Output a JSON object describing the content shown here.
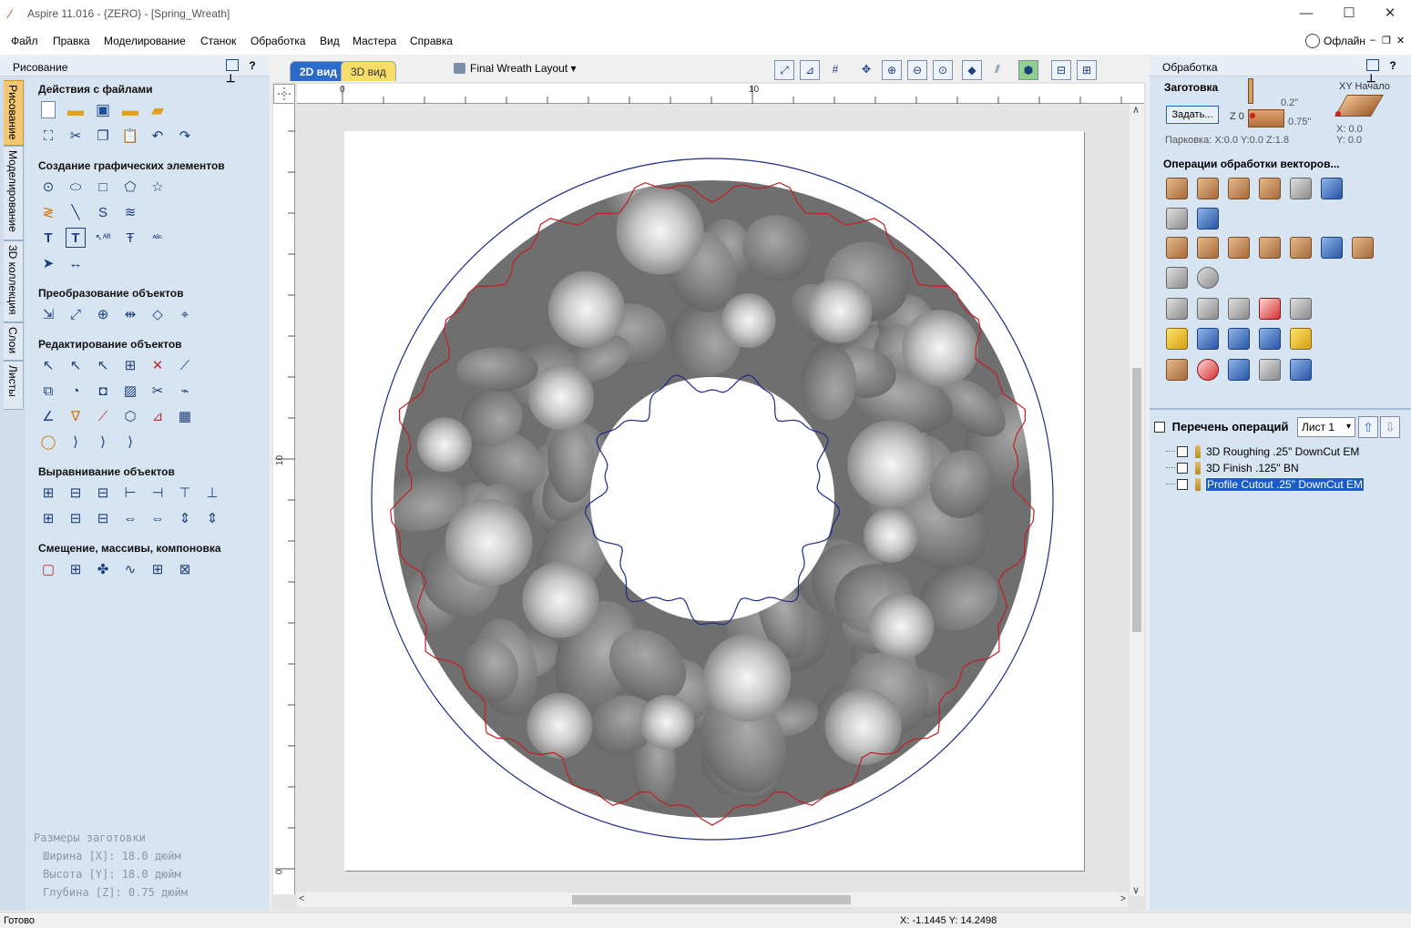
{
  "window": {
    "title": "Aspire 11.016 - {ZERO} - [Spring_Wreath]",
    "minimize": "—",
    "maximize": "☐",
    "close": "✕"
  },
  "menu": {
    "items": [
      "Файл",
      "Правка",
      "Моделирование",
      "Станок",
      "Обработка",
      "Вид",
      "Мастера",
      "Справка"
    ],
    "online": "Офлайн"
  },
  "left_panel": {
    "title": "Рисование",
    "tabs": [
      "Рисование",
      "Моделирование",
      "3D коллекция",
      "Слои",
      "Листы"
    ],
    "sections": [
      "Действия с файлами",
      "Создание графических элементов",
      "Преобразование объектов",
      "Редактирование объектов",
      "Выравнивание объектов",
      "Смещение, массивы, компоновка"
    ],
    "blank_info": {
      "title": "Размеры заготовки",
      "width": "Ширина  [X]: 18.0 дюйм",
      "height": "Высота  [Y]: 18.0 дюйм",
      "depth": "Глубина [Z]: 0.75 дюйм"
    }
  },
  "view": {
    "tab_2d": "2D вид",
    "tab_3d": "3D вид",
    "layout": "Final Wreath Layout",
    "ruler_h": [
      "0",
      "10"
    ],
    "ruler_v": [
      "10",
      "0"
    ]
  },
  "right_panel": {
    "title": "Обработка",
    "blank_label": "Заготовка",
    "set_button": "Задать...",
    "z_label": "Z 0",
    "dim_top": "0.2\"",
    "dim_bottom": "0.75\"",
    "xy_origin": "XY Начало",
    "x_val": "X: 0.0",
    "y_val": "Y: 0.0",
    "parking": "Парковка:  X:0.0 Y:0.0 Z:1.8",
    "vector_ops": "Операции обработки векторов...",
    "op_list_label": "Перечень операций",
    "sheet": "Лист 1",
    "operations": [
      "3D Roughing .25\" DownCut EM",
      "3D Finish .125\" BN",
      "Profile Cutout .25\" DownCut EM"
    ]
  },
  "status": {
    "left": "Готово",
    "coords": "X: -1.1445 Y: 14.2498"
  },
  "colors": {
    "panel_bg": "#d7e4f2",
    "tab_2d": "#2b6bc9",
    "tab_3d": "#f6dd6a",
    "selection": "#1b5cc7",
    "vector_outline": "#1c2a8a",
    "cutout_outline": "#c02020"
  }
}
